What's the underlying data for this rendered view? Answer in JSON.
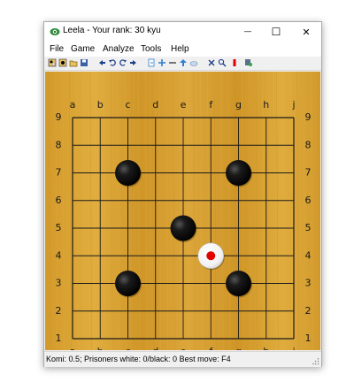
{
  "window": {
    "title": "Leela - Your rank: 30 kyu",
    "minimize_glyph": "—",
    "maximize_glyph": "☐",
    "close_glyph": "✕"
  },
  "menu": {
    "items": [
      "File",
      "Game",
      "Analyze",
      "Tools",
      "Help"
    ]
  },
  "toolbar": {
    "icons": [
      "new-game-icon",
      "open-icon",
      "open-folder-icon",
      "save-icon",
      "back-icon",
      "undo-icon",
      "redo-icon",
      "forward-icon",
      "resign-icon",
      "plus-icon",
      "minus-icon",
      "up-icon",
      "cloud-icon",
      "close-icon",
      "analyze-icon",
      "red-marker-icon",
      "settings-icon"
    ]
  },
  "board": {
    "size": 9,
    "columns": [
      "a",
      "b",
      "c",
      "d",
      "e",
      "f",
      "g",
      "h",
      "j"
    ],
    "rows": [
      "9",
      "8",
      "7",
      "6",
      "5",
      "4",
      "3",
      "2",
      "1"
    ],
    "wood_color": "#d9a431",
    "line_color": "#1a1a1a",
    "star_points": [
      "c7",
      "g7",
      "e5",
      "c3",
      "g3"
    ],
    "stones": [
      {
        "point": "c7",
        "color": "black"
      },
      {
        "point": "g7",
        "color": "black"
      },
      {
        "point": "e5",
        "color": "black"
      },
      {
        "point": "c3",
        "color": "black"
      },
      {
        "point": "g3",
        "color": "black"
      }
    ],
    "best_move": {
      "point": "f4",
      "color": "white",
      "marker_color": "#e00000"
    }
  },
  "status": {
    "text": "Komi: 0.5; Prisoners white: 0/black: 0 Best move: F4"
  }
}
